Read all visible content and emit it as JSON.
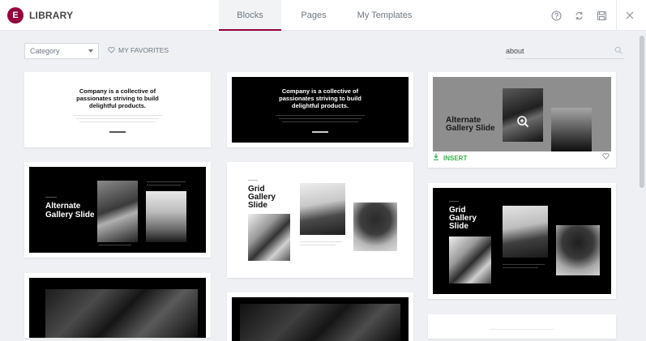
{
  "header": {
    "logo_letter": "E",
    "title": "LIBRARY",
    "tabs": [
      {
        "label": "Blocks",
        "active": true
      },
      {
        "label": "Pages",
        "active": false
      },
      {
        "label": "My Templates",
        "active": false
      }
    ],
    "icons": [
      "help-icon",
      "sync-icon",
      "save-icon",
      "close-icon"
    ]
  },
  "toolbar": {
    "category_label": "Category",
    "favorites_label": "MY FAVORITES",
    "search_value": "about"
  },
  "cards": {
    "company_heading_line1": "Company is a collective of",
    "company_heading_line2": "passionates striving to build",
    "company_heading_line3": "delightful products.",
    "alternate_title_line1": "Alternate",
    "alternate_title_line2": "Gallery Slide",
    "grid_title_line1": "Grid",
    "grid_title_line2": "Gallery",
    "grid_title_line3": "Slide",
    "insert_label": "INSERT"
  },
  "colors": {
    "brand": "#93003c",
    "insert_green": "#39b54a"
  }
}
